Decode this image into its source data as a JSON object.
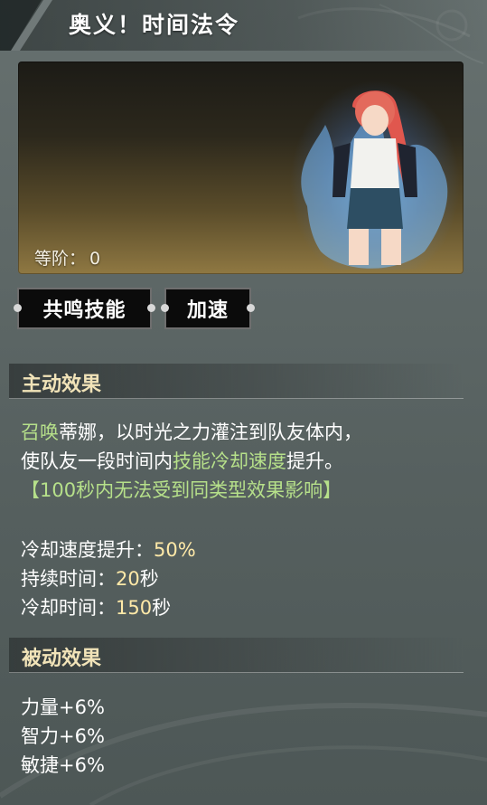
{
  "header": {
    "title": "奥义！时间法令"
  },
  "banner": {
    "level_label": "等阶：",
    "level_value": "0"
  },
  "tags": [
    {
      "label": "共鸣技能"
    },
    {
      "label": "加速"
    }
  ],
  "active": {
    "header": "主动效果",
    "desc": {
      "line1_hl": "召唤",
      "line1_rest": "蒂娜，以时光之力灌注到队友体内，",
      "line2_a": "使队友一段时间内",
      "line2_hl": "技能冷却速度",
      "line2_b": "提升。",
      "note": "【100秒内无法受到同类型效果影响】"
    },
    "stats": [
      {
        "label": "冷却速度提升：",
        "value": "50%",
        "unit": ""
      },
      {
        "label": "持续时间：",
        "value": "20",
        "unit": "秒"
      },
      {
        "label": "冷却时间：",
        "value": "150",
        "unit": "秒"
      }
    ]
  },
  "passive": {
    "header": "被动效果",
    "items": [
      "力量+6%",
      "智力+6%",
      "敏捷+6%"
    ]
  },
  "colors": {
    "highlight": "#b6e08a",
    "value": "#ffe9a8",
    "section_title": "#f1e3b8"
  }
}
